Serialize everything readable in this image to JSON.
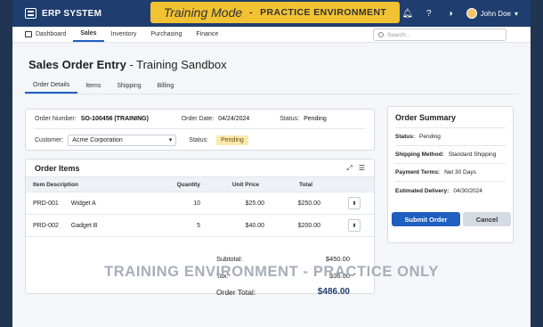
{
  "app": {
    "title": "ERP SYSTEM"
  },
  "banner": {
    "mode": "Training Mode",
    "sep": "-",
    "subtitle": "PRACTICE ENVIRONMENT"
  },
  "user": {
    "name": "John Doe"
  },
  "nav": {
    "items": [
      "Dashboard",
      "Sales",
      "Inventory",
      "Purchasing",
      "Finance"
    ],
    "active": "Sales"
  },
  "search": {
    "placeholder": "Search..."
  },
  "page": {
    "title_bold": "Sales Order Entry",
    "title_rest": " - Training Sandbox"
  },
  "tabs": [
    "Order Details",
    "Items",
    "Shipping",
    "Billing"
  ],
  "order": {
    "number_label": "Order Number:",
    "number": "SO-100456 (TRAINING)",
    "date_label": "Order Date:",
    "date": "04/24/2024",
    "status_label": "Status:",
    "status": "Pending",
    "customer_label": "Customer:",
    "customer": "Acme Corporation",
    "status2_label": "Status:",
    "status2": "Pending"
  },
  "items": {
    "title": "Order Items",
    "columns": {
      "desc": "Item Description",
      "qty": "Quantity",
      "price": "Unit Price",
      "total": "Total"
    },
    "rows": [
      {
        "code": "PRD-001",
        "name": "Widget A",
        "qty": "10",
        "price": "$25.00",
        "total": "$250.00"
      },
      {
        "code": "PRD-002",
        "name": "Gadget B",
        "qty": "5",
        "price": "$40.00",
        "total": "$200.00"
      }
    ],
    "subtotal_label": "Subtotal:",
    "subtotal": "$450.00",
    "tax_label": "Tax:",
    "tax": "$36.00",
    "total_label": "Order Total:",
    "total": "$486.00"
  },
  "summary": {
    "title": "Order Summary",
    "status_label": "Status:",
    "status": "Pending",
    "ship_label": "Shipping Method:",
    "ship": "Standard Shipping",
    "terms_label": "Payment Terms:",
    "terms": "Net 30 Days",
    "delivery_label": "Estimated Delivery:",
    "delivery": "04/30/2024"
  },
  "buttons": {
    "submit": "Submit Order",
    "cancel": "Cancel"
  },
  "watermark": "TRAINING ENVIRONMENT - PRACTICE ONLY",
  "colors": {
    "brand": "#1f3d6e",
    "accent": "#1f5fbf",
    "banner": "#f1c232",
    "pending": "#fde8b0"
  }
}
